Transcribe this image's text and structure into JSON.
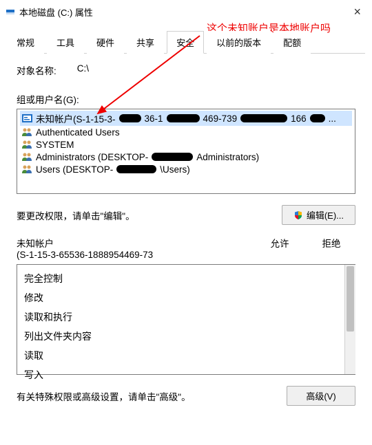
{
  "window": {
    "title": "本地磁盘 (C:) 属性",
    "close": "×"
  },
  "annotation": "这个未知账户是本地账户吗",
  "tabs": [
    "常规",
    "工具",
    "硬件",
    "共享",
    "安全",
    "以前的版本",
    "配额"
  ],
  "active_tab_index": 4,
  "object_label": "对象名称:",
  "object_value": "C:\\",
  "group_label": "组或用户名(G):",
  "principals": [
    {
      "icon": "sid",
      "parts": [
        "未知帐户(S-1-15-3-",
        "36-1",
        "469-739",
        "166",
        "..."
      ]
    },
    {
      "icon": "users",
      "parts": [
        "Authenticated Users"
      ]
    },
    {
      "icon": "users",
      "parts": [
        "SYSTEM"
      ]
    },
    {
      "icon": "users",
      "parts": [
        "Administrators (DESKTOP-",
        "Administrators)"
      ]
    },
    {
      "icon": "users",
      "parts": [
        "Users (DESKTOP-",
        "\\Users)"
      ]
    }
  ],
  "edit_hint": "要更改权限，请单击\"编辑\"。",
  "edit_button": "编辑(E)...",
  "selected_name": "未知帐户",
  "selected_sid": "(S-1-15-3-65536-1888954469-73",
  "allow_col": "允许",
  "deny_col": "拒绝",
  "permissions": [
    "完全控制",
    "修改",
    "读取和执行",
    "列出文件夹内容",
    "读取",
    "写入"
  ],
  "advanced_hint": "有关特殊权限或高级设置，请单击\"高级\"。",
  "advanced_button": "高级(V)"
}
